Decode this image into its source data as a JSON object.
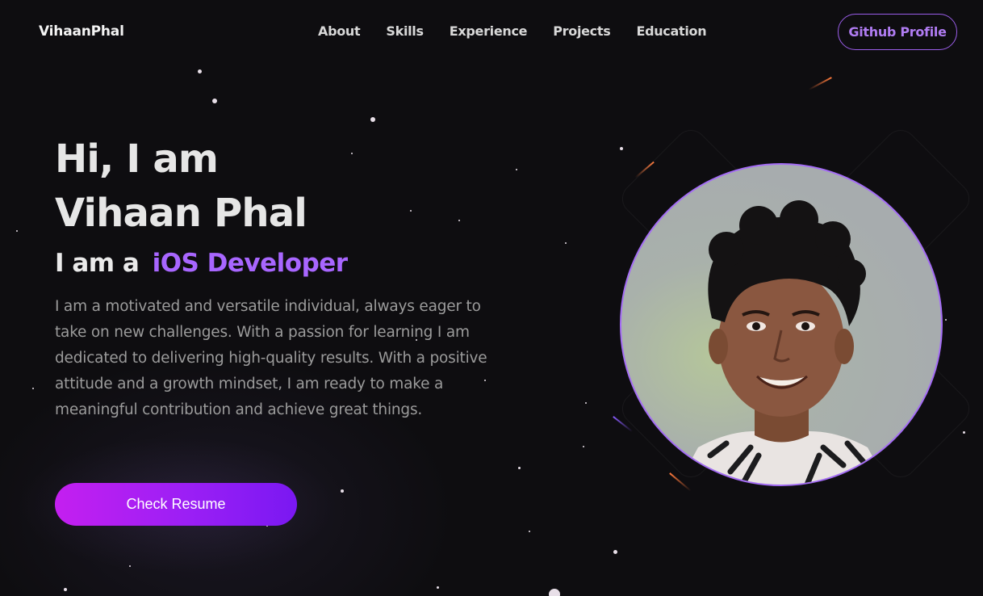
{
  "brand": {
    "logo": "VihaanPhal"
  },
  "nav": {
    "links": [
      "About",
      "Skills",
      "Experience",
      "Projects",
      "Education"
    ],
    "github_label": "Github Profile"
  },
  "hero": {
    "greeting_line1": "Hi, I am",
    "greeting_line2": "Vihaan Phal",
    "role_prefix": "I am a",
    "role_title": "iOS Developer",
    "bio": "I am a motivated and versatile individual, always eager to take on new challenges. With a passion for learning I am dedicated to delivering high-quality results. With a positive attitude and a growth mindset, I am ready to make a meaningful contribution and achieve great things.",
    "resume_label": "Check Resume"
  },
  "colors": {
    "background": "#0e0d10",
    "accent_purple": "#a866ff",
    "button_gradient_start": "#c41ff0",
    "button_gradient_end": "#7a18f2"
  },
  "icons": {
    "portrait": "profile-photo"
  }
}
